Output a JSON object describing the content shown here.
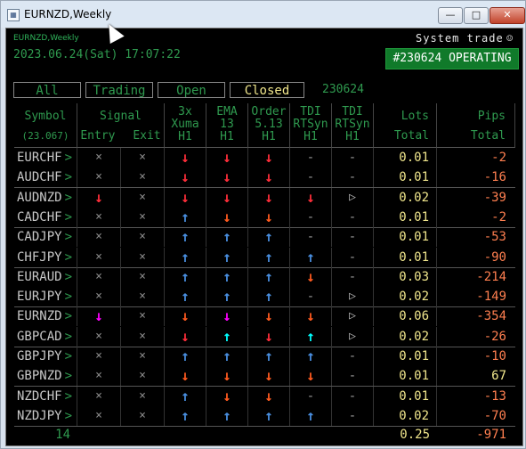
{
  "window": {
    "title": "EURNZD,Weekly",
    "min": "—",
    "max": "□",
    "close": "✕"
  },
  "header": {
    "chart_label": "EURNZD,Weekly",
    "datetime": "2023.06.24(Sat) 17:07:22",
    "system": "System trade",
    "smiley": "☺",
    "status_badge": "#230624 OPERATING"
  },
  "filters": {
    "all": "All",
    "trading": "Trading",
    "open": "Open",
    "closed": "Closed",
    "date": "230624",
    "active": "Closed"
  },
  "columns": {
    "symbol": [
      "Symbol",
      "(23.067)"
    ],
    "signal": [
      "Signal"
    ],
    "entry": "Entry",
    "exit": "Exit",
    "xuma": [
      "3x",
      "Xuma",
      "H1"
    ],
    "ema": [
      "EMA",
      "13",
      "H1"
    ],
    "order": [
      "Order",
      "5.13",
      "H1"
    ],
    "tdi1": [
      "TDI",
      "RTSyn",
      "H1"
    ],
    "tdi2": [
      "TDI",
      "RTSyn",
      "H1"
    ],
    "lots": [
      "Lots",
      "Total"
    ],
    "pips": [
      "Pips",
      "Total"
    ]
  },
  "colors": {
    "green": "#2f9a4f",
    "down": "#ff2e3a",
    "down_orange": "#ff5a1f",
    "up_blue": "#4a90e2",
    "cyan": "#00ffff",
    "magenta": "#ff00ff",
    "yellow": "#f0e68c",
    "orange": "#ff7f50"
  },
  "rows": [
    {
      "symbol": "EURCHF",
      "entry": "×",
      "exit": "×",
      "xuma": "↓",
      "xuma_c": "#ff2e3a",
      "ema": "↓",
      "ema_c": "#ff2e3a",
      "order": "↓",
      "order_c": "#ff2e3a",
      "tdi1": "-",
      "tdi1_c": "#9a9a9a",
      "tdi2": "-",
      "tdi2_c": "#9a9a9a",
      "lots": "0.01",
      "pips": "-2",
      "pips_neg": true
    },
    {
      "symbol": "AUDCHF",
      "entry": "×",
      "exit": "×",
      "xuma": "↓",
      "xuma_c": "#ff2e3a",
      "ema": "↓",
      "ema_c": "#ff2e3a",
      "order": "↓",
      "order_c": "#ff2e3a",
      "tdi1": "-",
      "tdi1_c": "#9a9a9a",
      "tdi2": "-",
      "tdi2_c": "#9a9a9a",
      "lots": "0.01",
      "pips": "-16",
      "pips_neg": true
    },
    {
      "symbol": "AUDNZD",
      "entry": "↓",
      "entry_c": "#ff2e3a",
      "exit": "×",
      "xuma": "↓",
      "xuma_c": "#ff2e3a",
      "ema": "↓",
      "ema_c": "#ff2e3a",
      "order": "↓",
      "order_c": "#ff2e3a",
      "tdi1": "↓",
      "tdi1_c": "#ff2e3a",
      "tdi2": "▷",
      "tdi2_c": "#bbbbbb",
      "lots": "0.02",
      "pips": "-39",
      "pips_neg": true
    },
    {
      "symbol": "CADCHF",
      "entry": "×",
      "exit": "×",
      "xuma": "↑",
      "xuma_c": "#4a90e2",
      "ema": "↓",
      "ema_c": "#ff5a1f",
      "order": "↓",
      "order_c": "#ff5a1f",
      "tdi1": "-",
      "tdi1_c": "#9a9a9a",
      "tdi2": "-",
      "tdi2_c": "#9a9a9a",
      "lots": "0.01",
      "pips": "-2",
      "pips_neg": true
    },
    {
      "symbol": "CADJPY",
      "entry": "×",
      "exit": "×",
      "xuma": "↑",
      "xuma_c": "#4a90e2",
      "ema": "↑",
      "ema_c": "#4a90e2",
      "order": "↑",
      "order_c": "#4a90e2",
      "tdi1": "-",
      "tdi1_c": "#9a9a9a",
      "tdi2": "-",
      "tdi2_c": "#9a9a9a",
      "lots": "0.01",
      "pips": "-53",
      "pips_neg": true
    },
    {
      "symbol": "CHFJPY",
      "entry": "×",
      "exit": "×",
      "xuma": "↑",
      "xuma_c": "#4a90e2",
      "ema": "↑",
      "ema_c": "#4a90e2",
      "order": "↑",
      "order_c": "#4a90e2",
      "tdi1": "↑",
      "tdi1_c": "#4a90e2",
      "tdi2": "-",
      "tdi2_c": "#9a9a9a",
      "lots": "0.01",
      "pips": "-90",
      "pips_neg": true
    },
    {
      "symbol": "EURAUD",
      "entry": "×",
      "exit": "×",
      "xuma": "↑",
      "xuma_c": "#4a90e2",
      "ema": "↑",
      "ema_c": "#4a90e2",
      "order": "↑",
      "order_c": "#4a90e2",
      "tdi1": "↓",
      "tdi1_c": "#ff5a1f",
      "tdi2": "-",
      "tdi2_c": "#9a9a9a",
      "lots": "0.03",
      "pips": "-214",
      "pips_neg": true
    },
    {
      "symbol": "EURJPY",
      "entry": "×",
      "exit": "×",
      "xuma": "↑",
      "xuma_c": "#4a90e2",
      "ema": "↑",
      "ema_c": "#4a90e2",
      "order": "↑",
      "order_c": "#4a90e2",
      "tdi1": "-",
      "tdi1_c": "#9a9a9a",
      "tdi2": "▷",
      "tdi2_c": "#bbbbbb",
      "lots": "0.02",
      "pips": "-149",
      "pips_neg": true
    },
    {
      "symbol": "EURNZD",
      "entry": "↓",
      "entry_c": "#ff00ff",
      "exit": "×",
      "xuma": "↓",
      "xuma_c": "#ff5a1f",
      "ema": "↓",
      "ema_c": "#ff00ff",
      "order": "↓",
      "order_c": "#ff5a1f",
      "tdi1": "↓",
      "tdi1_c": "#ff5a1f",
      "tdi2": "▷",
      "tdi2_c": "#bbbbbb",
      "lots": "0.06",
      "pips": "-354",
      "pips_neg": true
    },
    {
      "symbol": "GBPCAD",
      "entry": "×",
      "exit": "×",
      "xuma": "↓",
      "xuma_c": "#ff2e3a",
      "ema": "↑",
      "ema_c": "#00ffff",
      "order": "↓",
      "order_c": "#ff2e3a",
      "tdi1": "↑",
      "tdi1_c": "#00ffff",
      "tdi2": "▷",
      "tdi2_c": "#bbbbbb",
      "lots": "0.02",
      "pips": "-26",
      "pips_neg": true
    },
    {
      "symbol": "GBPJPY",
      "entry": "×",
      "exit": "×",
      "xuma": "↑",
      "xuma_c": "#4a90e2",
      "ema": "↑",
      "ema_c": "#4a90e2",
      "order": "↑",
      "order_c": "#4a90e2",
      "tdi1": "↑",
      "tdi1_c": "#4a90e2",
      "tdi2": "-",
      "tdi2_c": "#9a9a9a",
      "lots": "0.01",
      "pips": "-10",
      "pips_neg": true
    },
    {
      "symbol": "GBPNZD",
      "entry": "×",
      "exit": "×",
      "xuma": "↓",
      "xuma_c": "#ff5a1f",
      "ema": "↓",
      "ema_c": "#ff5a1f",
      "order": "↓",
      "order_c": "#ff5a1f",
      "tdi1": "↓",
      "tdi1_c": "#ff5a1f",
      "tdi2": "-",
      "tdi2_c": "#9a9a9a",
      "lots": "0.01",
      "pips": "67",
      "pips_neg": false
    },
    {
      "symbol": "NZDCHF",
      "entry": "×",
      "exit": "×",
      "xuma": "↑",
      "xuma_c": "#4a90e2",
      "ema": "↓",
      "ema_c": "#ff5a1f",
      "order": "↓",
      "order_c": "#ff5a1f",
      "tdi1": "-",
      "tdi1_c": "#9a9a9a",
      "tdi2": "-",
      "tdi2_c": "#9a9a9a",
      "lots": "0.01",
      "pips": "-13",
      "pips_neg": true
    },
    {
      "symbol": "NZDJPY",
      "entry": "×",
      "exit": "×",
      "xuma": "↑",
      "xuma_c": "#4a90e2",
      "ema": "↑",
      "ema_c": "#4a90e2",
      "order": "↑",
      "order_c": "#4a90e2",
      "tdi1": "↑",
      "tdi1_c": "#4a90e2",
      "tdi2": "-",
      "tdi2_c": "#9a9a9a",
      "lots": "0.02",
      "pips": "-70",
      "pips_neg": true
    }
  ],
  "footer": {
    "count": "14",
    "lots_total": "0.25",
    "pips_total": "-971"
  }
}
